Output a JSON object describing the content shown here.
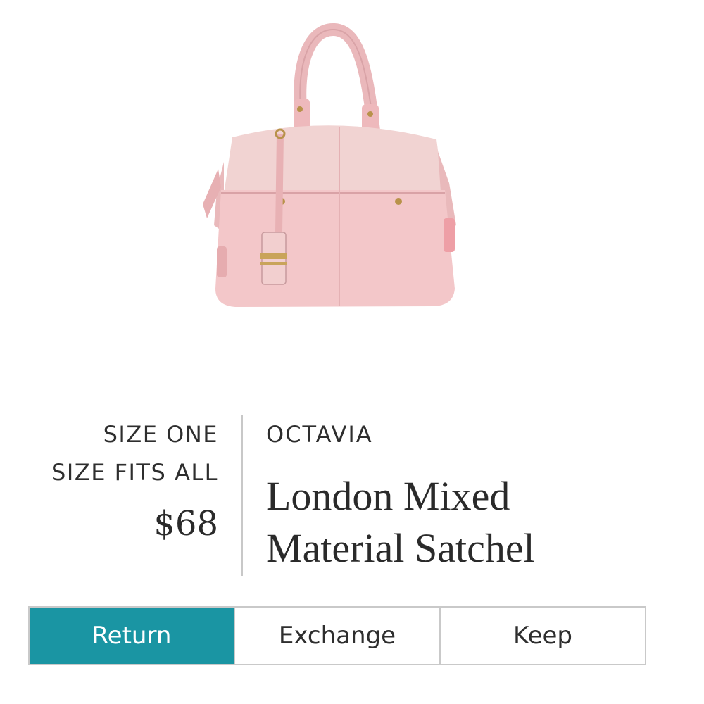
{
  "product": {
    "image": "pink leather satchel handbag with gold hardware and tag",
    "size_label": "SIZE ONE",
    "size_value": "SIZE FITS ALL",
    "price": "$68",
    "brand": "OCTAVIA",
    "name_line1": "London Mixed",
    "name_line2": "Material Satchel"
  },
  "actions": {
    "selected": "Return",
    "return_label": "Return",
    "exchange_label": "Exchange",
    "keep_label": "Keep"
  },
  "colors": {
    "accent": "#1a95a3",
    "bag_pink": "#f3c7c9",
    "bag_pink_light": "#f1d3d2",
    "hardware_gold": "#b8924a",
    "text": "#2a2a2a",
    "divider": "#c8c8c8"
  }
}
